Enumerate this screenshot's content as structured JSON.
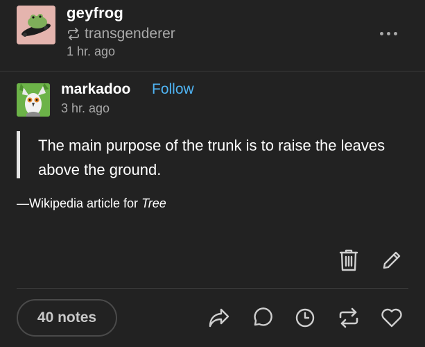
{
  "post": {
    "blog_name": "geyfrog",
    "reblogged_from": "transgenderer",
    "time": "1 hr. ago"
  },
  "trail": {
    "blog_name": "markadoo",
    "follow_label": "Follow",
    "time": "3 hr. ago",
    "quote": "The main purpose of the trunk is to raise the leaves above the ground.",
    "attribution_prefix": "—Wikipedia article for ",
    "attribution_title": "Tree"
  },
  "footer": {
    "notes_label": "40 notes"
  },
  "icons": {
    "more": "more-dots-icon",
    "reblog_small": "reblog-icon",
    "delete": "trash-icon",
    "edit": "pencil-icon",
    "share": "share-arrow-icon",
    "reply": "speech-bubble-icon",
    "queue": "clock-icon",
    "reblog": "reblog-icon",
    "like": "heart-icon"
  },
  "colors": {
    "background": "#222222",
    "muted_text": "#a9a9a9",
    "follow_link": "#4fb3f2",
    "icon": "#cfcfcf"
  }
}
